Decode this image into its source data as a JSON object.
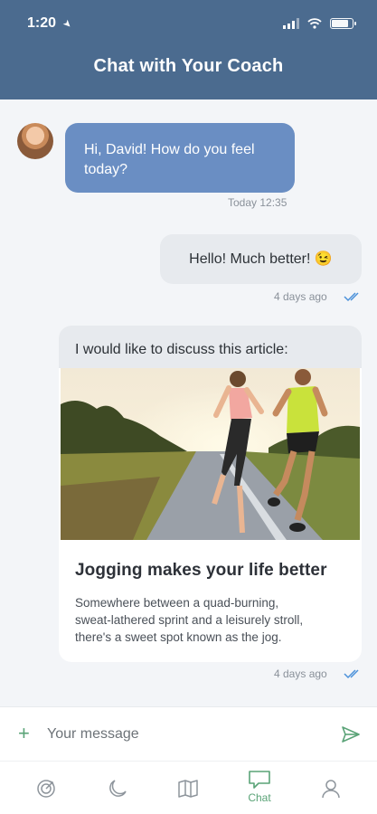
{
  "status_bar": {
    "time": "1:20"
  },
  "header": {
    "title": "Chat with Your Coach"
  },
  "messages": {
    "coach_greeting": {
      "line1": "Hi, David! How do you feel",
      "line2": "today?",
      "timestamp": "Today 12:35"
    },
    "user_reply": {
      "text": "Hello! Much better! 😉",
      "timestamp": "4 days ago"
    },
    "article_share": {
      "intro": "I would like to discuss this article:",
      "title": "Jogging makes your life better",
      "desc_line1": "Somewhere between a quad-burning,",
      "desc_line2": "sweat-lathered sprint and a leisurely stroll,",
      "desc_line3": "there's a sweet spot known as the jog.",
      "timestamp": "4 days ago"
    }
  },
  "composer": {
    "placeholder": "Your message"
  },
  "tabbar": {
    "items": [
      {
        "icon": "target-icon",
        "label": ""
      },
      {
        "icon": "moon-icon",
        "label": ""
      },
      {
        "icon": "book-icon",
        "label": ""
      },
      {
        "icon": "chat-icon",
        "label": "Chat",
        "active": true
      },
      {
        "icon": "profile-icon",
        "label": ""
      }
    ]
  },
  "colors": {
    "header": "#4b6b8f",
    "incoming_bubble": "#6a8ec3",
    "outgoing_bubble": "#e7eaee",
    "accent": "#5aa377",
    "read_ticks": "#4a90d9"
  }
}
